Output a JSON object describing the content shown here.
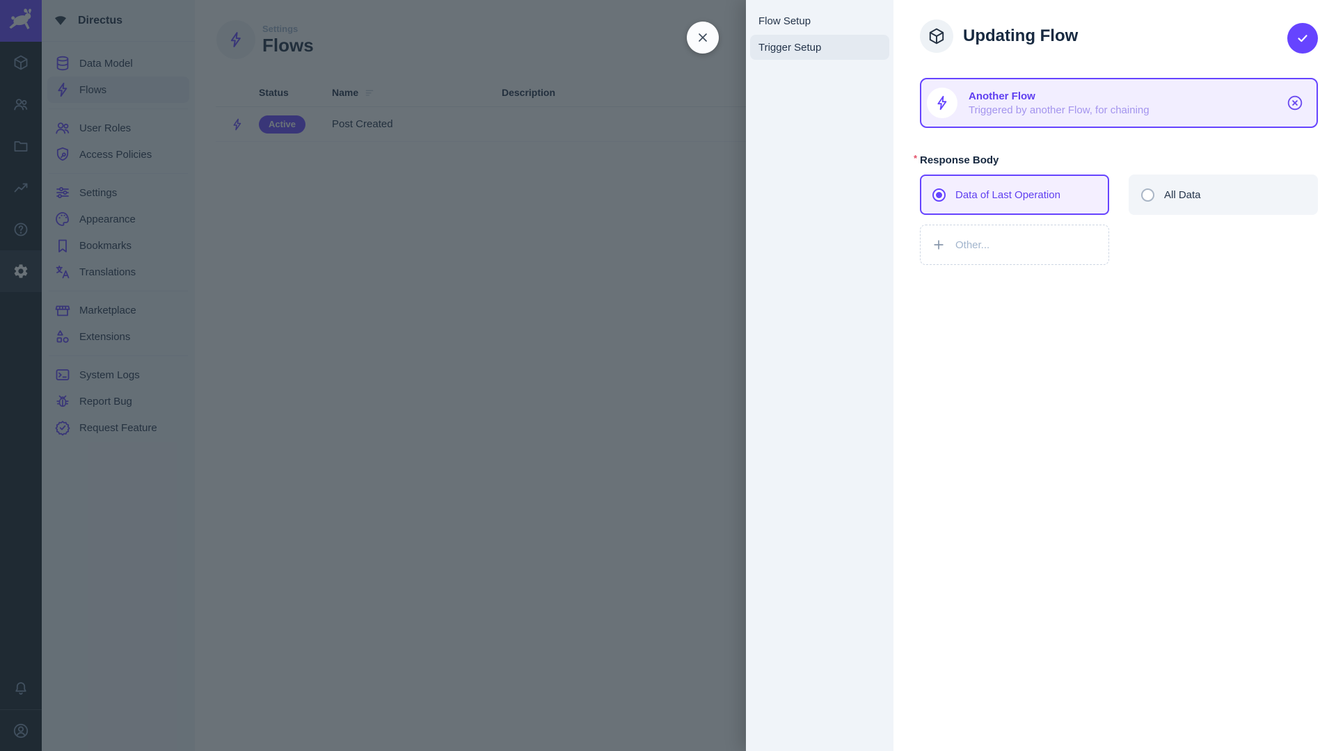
{
  "app": {
    "name": "Directus"
  },
  "module_bar": {
    "logo_icon": "directus-rabbit-icon",
    "modules": [
      {
        "icon": "box-icon",
        "name": "content"
      },
      {
        "icon": "people-icon",
        "name": "users"
      },
      {
        "icon": "folder-icon",
        "name": "files"
      },
      {
        "icon": "chart-icon",
        "name": "insights"
      },
      {
        "icon": "help-icon",
        "name": "docs"
      },
      {
        "icon": "gear-icon",
        "name": "settings",
        "active": true
      }
    ],
    "bottom": [
      {
        "icon": "bell-icon",
        "name": "notifications"
      },
      {
        "icon": "user-circle-icon",
        "name": "account"
      }
    ]
  },
  "nav": {
    "project": {
      "icon": "fan-icon",
      "title": "Directus"
    },
    "groups": [
      {
        "items": [
          {
            "icon": "database-icon",
            "label": "Data Model"
          },
          {
            "icon": "bolt-icon",
            "label": "Flows",
            "active": true
          }
        ]
      },
      {
        "items": [
          {
            "icon": "people-icon",
            "label": "User Roles"
          },
          {
            "icon": "shield-key-icon",
            "label": "Access Policies"
          }
        ]
      },
      {
        "items": [
          {
            "icon": "tune-icon",
            "label": "Settings"
          },
          {
            "icon": "palette-icon",
            "label": "Appearance"
          },
          {
            "icon": "bookmark-icon",
            "label": "Bookmarks"
          },
          {
            "icon": "translate-icon",
            "label": "Translations"
          }
        ]
      },
      {
        "items": [
          {
            "icon": "storefront-icon",
            "label": "Marketplace"
          },
          {
            "icon": "shapes-icon",
            "label": "Extensions"
          }
        ]
      },
      {
        "items": [
          {
            "icon": "terminal-icon",
            "label": "System Logs"
          },
          {
            "icon": "bug-icon",
            "label": "Report Bug"
          },
          {
            "icon": "verified-icon",
            "label": "Request Feature"
          }
        ]
      }
    ]
  },
  "main": {
    "breadcrumb": "Settings",
    "title": "Flows",
    "title_icon": "bolt-icon",
    "table": {
      "columns": [
        "Status",
        "Name",
        "Description"
      ],
      "rows": [
        {
          "icon": "bolt-icon",
          "status": "Active",
          "name": "Post Created",
          "description": ""
        }
      ]
    }
  },
  "drawer": {
    "nav": [
      {
        "label": "Flow Setup"
      },
      {
        "label": "Trigger Setup",
        "active": true
      }
    ],
    "title": "Updating Flow",
    "title_icon": "box-icon",
    "save_icon": "check-icon",
    "close_icon": "close-icon",
    "trigger_card": {
      "icon": "bolt-icon",
      "title": "Another Flow",
      "subtitle": "Triggered by another Flow, for chaining",
      "deselect_icon": "circle-x-icon"
    },
    "response_body": {
      "label": "Response Body",
      "required": true,
      "options": [
        {
          "label": "Data of Last Operation",
          "selected": true
        },
        {
          "label": "All Data",
          "selected": false
        }
      ],
      "other": {
        "icon": "plus-icon",
        "label": "Other..."
      }
    }
  },
  "colors": {
    "accent": "#6644ff",
    "module_bar_bg": "#161f2b",
    "nav_bg": "#f0f4f9",
    "nav_active_bg": "#e4eaf1",
    "text_strong": "#172940",
    "text_subdued": "#a2b5cd",
    "overlay": "rgba(36,47,56,0.68)",
    "card_bg": "#f2eeff",
    "card_subtitle": "#a495ee",
    "required_red": "#e35169"
  }
}
